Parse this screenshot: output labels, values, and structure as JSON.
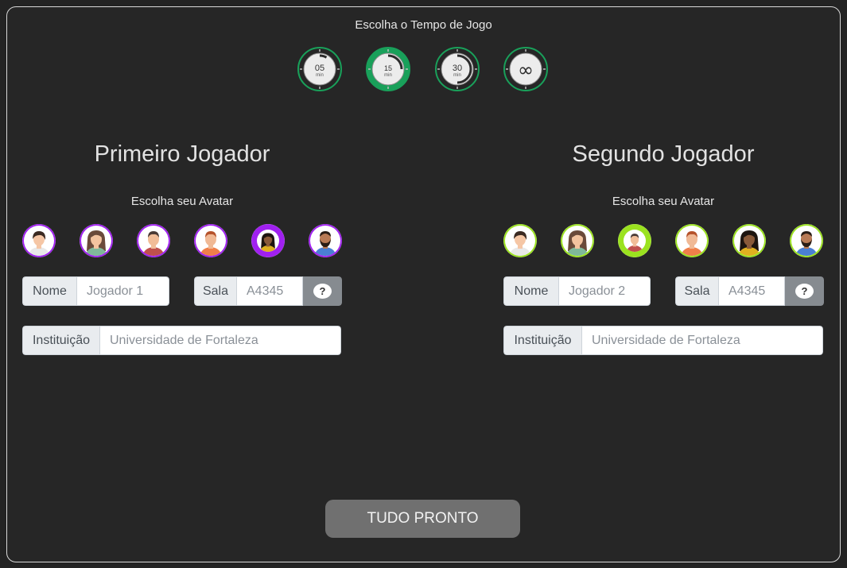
{
  "time_selector": {
    "title": "Escolha o Tempo de Jogo",
    "options": [
      {
        "value": "05",
        "unit": "min",
        "selected": false
      },
      {
        "value": "15",
        "unit": "min",
        "selected": true
      },
      {
        "value": "30",
        "unit": "min",
        "selected": false
      },
      {
        "value": "∞",
        "unit": "",
        "selected": false
      }
    ]
  },
  "player1": {
    "title": "Primeiro Jogador",
    "avatar_label": "Escolha seu Avatar",
    "avatar_ring_color": "#a020f0",
    "selected_avatar": 4,
    "name_label": "Nome",
    "name_placeholder": "Jogador 1",
    "room_label": "Sala",
    "room_placeholder": "A4345",
    "help_label": "?",
    "institution_label": "Instituição",
    "institution_placeholder": "Universidade de Fortaleza"
  },
  "player2": {
    "title": "Segundo Jogador",
    "avatar_label": "Escolha seu Avatar",
    "avatar_ring_color": "#9be21f",
    "selected_avatar": 2,
    "name_label": "Nome",
    "name_placeholder": "Jogador 2",
    "room_label": "Sala",
    "room_placeholder": "A4345",
    "help_label": "?",
    "institution_label": "Instituição",
    "institution_placeholder": "Universidade de Fortaleza"
  },
  "avatars": [
    {
      "name": "woman-short-hair-avatar",
      "skin": "#f5c6a5",
      "hair": "#3b2a22",
      "shirt": "#e8e8e8",
      "style": "short"
    },
    {
      "name": "woman-long-hair-avatar",
      "skin": "#f3c39f",
      "hair": "#6a4a3a",
      "shirt": "#7fb89a",
      "style": "long"
    },
    {
      "name": "man-dark-hair-avatar",
      "skin": "#f1bd98",
      "hair": "#4a3a35",
      "shirt": "#c0504d",
      "style": "man"
    },
    {
      "name": "man-red-hair-avatar",
      "skin": "#f0b995",
      "hair": "#b5522b",
      "shirt": "#ef7f4a",
      "style": "man"
    },
    {
      "name": "woman-dark-skin-avatar",
      "skin": "#8a5a3a",
      "hair": "#1e1510",
      "shirt": "#e0b020",
      "style": "long"
    },
    {
      "name": "man-beard-avatar",
      "skin": "#b87a55",
      "hair": "#2a1d16",
      "shirt": "#4a7fd4",
      "style": "beard"
    }
  ],
  "ready_button": {
    "label": "TUDO PRONTO"
  },
  "colors": {
    "accent_green": "#19a05a",
    "background": "#262626",
    "button_gray": "#707070"
  }
}
